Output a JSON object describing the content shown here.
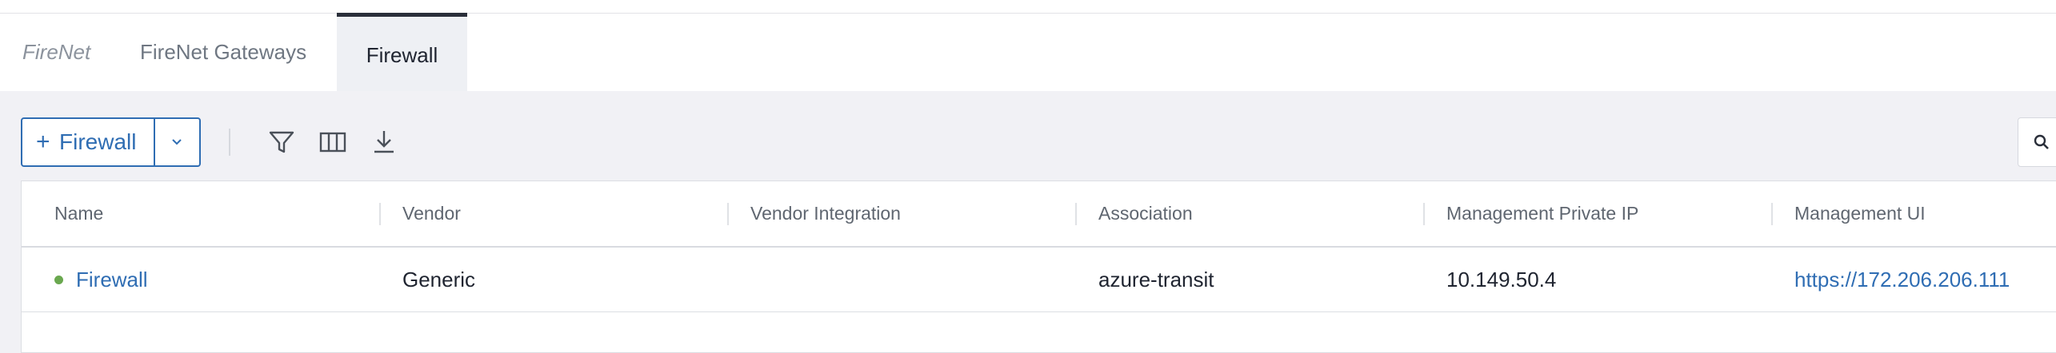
{
  "tabs": [
    {
      "label": "FireNet"
    },
    {
      "label": "FireNet Gateways"
    },
    {
      "label": "Firewall"
    }
  ],
  "toolbar": {
    "add_label": "Firewall",
    "add_plus": "+",
    "icons": [
      "filter-icon",
      "columns-icon",
      "download-icon",
      "search-icon",
      "chevron-down-icon"
    ]
  },
  "table": {
    "columns": [
      "Name",
      "Vendor",
      "Vendor Integration",
      "Association",
      "Management Private IP",
      "Management UI"
    ],
    "rows": [
      {
        "name": "Firewall",
        "status_color": "#6aa84f",
        "vendor": "Generic",
        "vendor_integration": "",
        "association": "azure-transit",
        "management_private_ip": "10.149.50.4",
        "management_ui": "https://172.206.206.111"
      }
    ]
  },
  "colors": {
    "accent": "#2f6db3",
    "status_ok": "#6aa84f"
  }
}
